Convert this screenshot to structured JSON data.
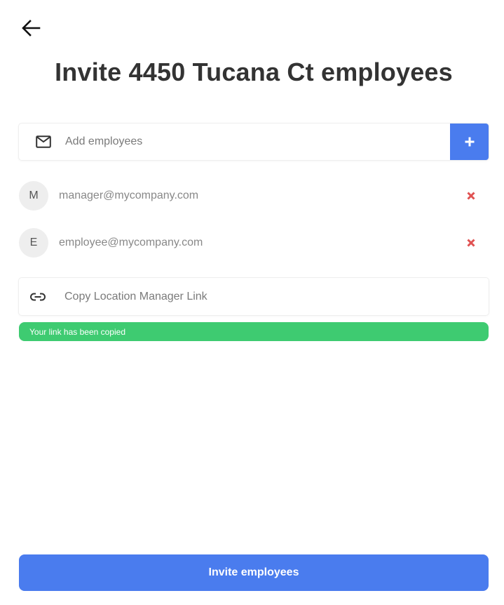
{
  "header": {
    "back_icon": "arrow-left-icon",
    "title": "Invite 4450 Tucana Ct employees"
  },
  "add_employees": {
    "icon": "mail-icon",
    "placeholder": "Add employees",
    "value": "",
    "add_icon": "plus-icon"
  },
  "invitees": [
    {
      "initial": "M",
      "email": "manager@mycompany.com",
      "remove_icon": "close-icon"
    },
    {
      "initial": "E",
      "email": "employee@mycompany.com",
      "remove_icon": "close-icon"
    }
  ],
  "copy_link": {
    "icon": "link-icon",
    "label": "Copy Location Manager Link"
  },
  "toast": {
    "message": "Your link has been copied"
  },
  "footer": {
    "invite_label": "Invite employees"
  },
  "colors": {
    "accent": "#4a7cee",
    "success": "#3ecb71",
    "danger": "#e05252"
  }
}
